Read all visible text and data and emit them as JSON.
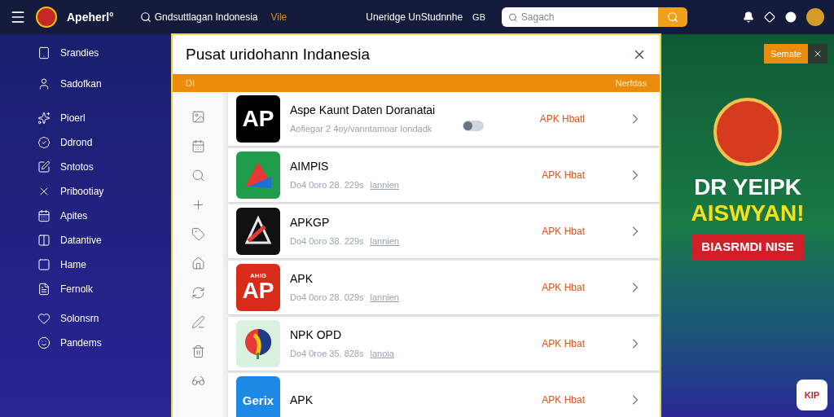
{
  "topbar": {
    "brand": "Apeherl°",
    "nav_search": "Gndsuttlagan Indonesia",
    "nav_tag": "Vile",
    "nav_link": "Uneridge UnStudnnhe",
    "nav_badge": "GB",
    "search": {
      "placeholder": "Sagach"
    }
  },
  "sidebar": {
    "items": [
      {
        "label": "Srandies"
      },
      {
        "label": "Sadofkan"
      },
      {
        "label": "Pioerl"
      },
      {
        "label": "Ddrond"
      },
      {
        "label": "Sntotos"
      },
      {
        "label": "Pribootiay"
      },
      {
        "label": "Apites"
      },
      {
        "label": "Datantive"
      },
      {
        "label": "Hame"
      },
      {
        "label": "Fernolk"
      },
      {
        "label": "Solonsrn"
      },
      {
        "label": "Pandems"
      }
    ]
  },
  "dialog": {
    "title": "Pusat uridohann Indanesia",
    "bar_left": "DI",
    "bar_right": "Nerfdas",
    "apps": [
      {
        "title": "Aspe Kaunt Daten Doranatai",
        "subtitle": "Aofiegar 2 4oy/vanntamoar Iondadk",
        "action": "APK Hbatl",
        "logo_text": "AP",
        "toggle": false
      },
      {
        "title": "AIMPIS",
        "subtitle": "Do4 0oro 28. 229s",
        "link": "lannien",
        "action": "APK Hbat"
      },
      {
        "title": "APKGP",
        "subtitle": "Do4 0oro 38. 229s",
        "link": "lannien",
        "action": "APK Hbat"
      },
      {
        "title": "APK",
        "subtitle": "Do4 0oro 28. 029s",
        "link": "lannien",
        "action": "APK Hbat",
        "logo_text": "AP",
        "logo_caption": "AHIG"
      },
      {
        "title": "NPK OPD",
        "subtitle": "Do4 0roe 35. 828s",
        "link": "lanoia",
        "action": "APK Hbat"
      },
      {
        "title": "APK",
        "action": "APK Hbat",
        "logo_text": "Gerix"
      }
    ]
  },
  "promo": {
    "close_label": "Semate",
    "headline_1": "DR YEIPK",
    "headline_2": "AISWYAN!",
    "ribbon": "BIASRMDI NISE",
    "corner_button": "KIP"
  }
}
